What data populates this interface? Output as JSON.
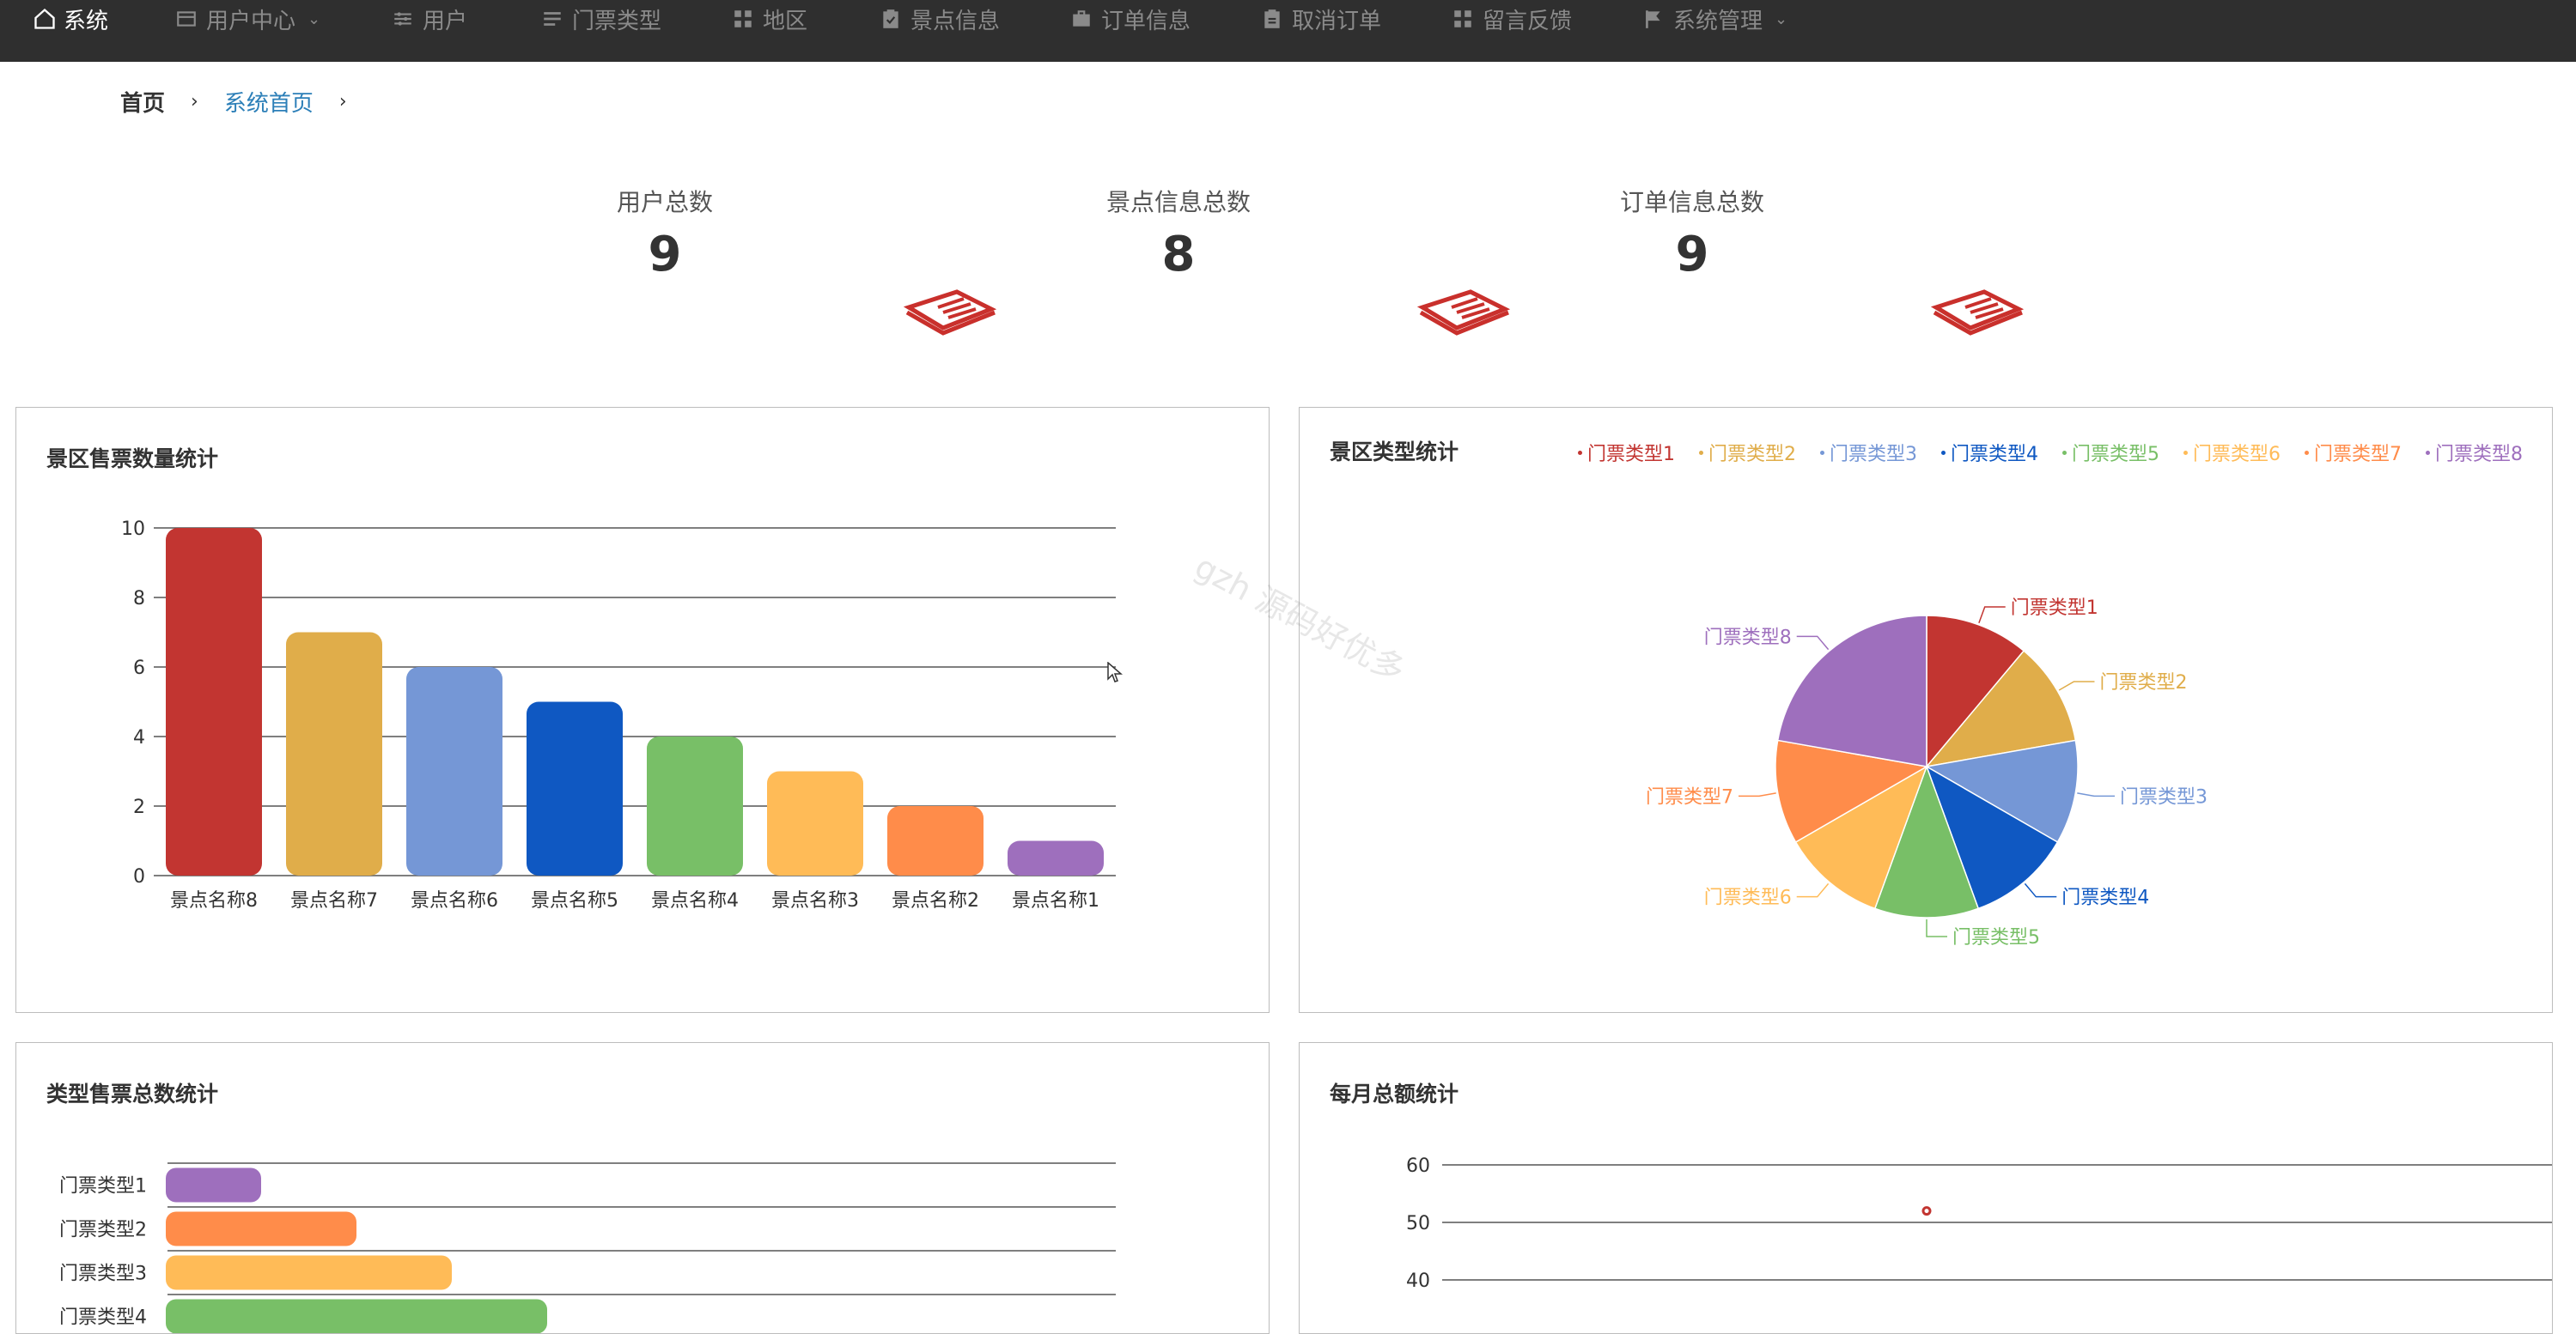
{
  "nav": {
    "brand": "系统",
    "items": [
      {
        "label": "用户中心",
        "icon": "card-icon",
        "dropdown": true
      },
      {
        "label": "用户",
        "icon": "sliders-icon",
        "dropdown": false
      },
      {
        "label": "门票类型",
        "icon": "list-icon",
        "dropdown": false
      },
      {
        "label": "地区",
        "icon": "grid-icon",
        "dropdown": false
      },
      {
        "label": "景点信息",
        "icon": "clipboard-check-icon",
        "dropdown": false
      },
      {
        "label": "订单信息",
        "icon": "briefcase-icon",
        "dropdown": false
      },
      {
        "label": "取消订单",
        "icon": "clipboard-icon",
        "dropdown": false
      },
      {
        "label": "留言反馈",
        "icon": "grid-icon",
        "dropdown": false
      },
      {
        "label": "系统管理",
        "icon": "flag-icon",
        "dropdown": true
      }
    ]
  },
  "breadcrumb": {
    "home": "首页",
    "current": "系统首页"
  },
  "stats": [
    {
      "label": "用户总数",
      "value": "9"
    },
    {
      "label": "景点信息总数",
      "value": "8"
    },
    {
      "label": "订单信息总数",
      "value": "9"
    }
  ],
  "panels": {
    "bar": {
      "title": "景区售票数量统计"
    },
    "pie": {
      "title": "景区类型统计"
    },
    "hbar": {
      "title": "类型售票总数统计"
    },
    "line": {
      "title": "每月总额统计"
    }
  },
  "watermark": "gzh 源码好优多",
  "colors": {
    "palette": [
      "#c23531",
      "#e0ad4a",
      "#7597d6",
      "#0f58c2",
      "#78bf67",
      "#ffbb57",
      "#ff8c4a",
      "#9e6fbd"
    ],
    "nav_bg": "#2f2f2f",
    "accent_red": "#c9302c"
  },
  "chart_data": [
    {
      "type": "bar",
      "title": "景区售票数量统计",
      "categories": [
        "景点名称8",
        "景点名称7",
        "景点名称6",
        "景点名称5",
        "景点名称4",
        "景点名称3",
        "景点名称2",
        "景点名称1"
      ],
      "values": [
        10,
        7,
        6,
        5,
        4,
        3,
        2,
        1
      ],
      "ylim": [
        0,
        10
      ],
      "yticks": [
        "0",
        "2",
        "4",
        "6",
        "8",
        "10"
      ],
      "grid": true
    },
    {
      "type": "pie",
      "title": "景区类型统计",
      "categories": [
        "门票类型1",
        "门票类型2",
        "门票类型3",
        "门票类型4",
        "门票类型5",
        "门票类型6",
        "门票类型7",
        "门票类型8"
      ],
      "values": [
        1,
        1,
        1,
        1,
        1,
        1,
        1,
        2
      ],
      "legend": "top-right"
    },
    {
      "type": "bar",
      "orientation": "horizontal",
      "title": "类型售票总数统计",
      "categories": [
        "门票类型1",
        "门票类型2",
        "门票类型3",
        "门票类型4"
      ],
      "values": [
        1,
        2,
        3,
        4
      ],
      "xlim": [
        0,
        10
      ],
      "grid": true
    },
    {
      "type": "scatter",
      "title": "每月总额统计",
      "points": [
        {
          "y": 52
        }
      ],
      "ylim": [
        30,
        60
      ],
      "yticks": [
        "40",
        "50",
        "60"
      ],
      "grid": true
    }
  ]
}
